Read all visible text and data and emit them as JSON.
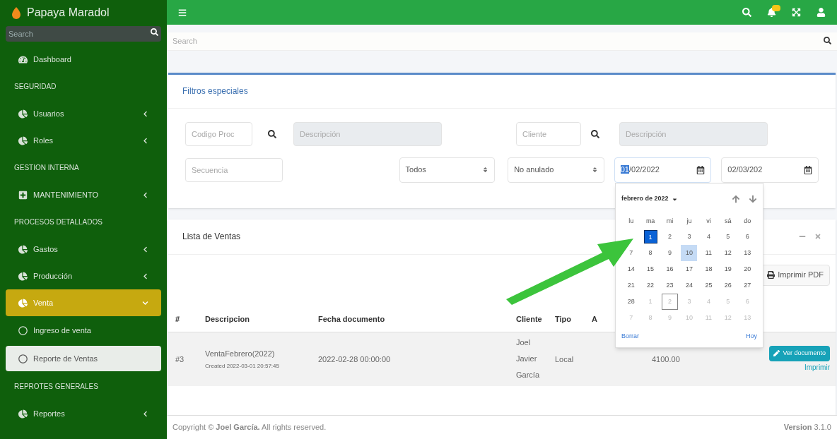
{
  "brand": {
    "name": "Papaya Maradol"
  },
  "sidebar": {
    "search": {
      "placeholder": "Search"
    },
    "items": [
      {
        "kind": "item",
        "label": "Dashboard",
        "selected": false,
        "expandable": false,
        "expanded": false
      },
      {
        "kind": "header",
        "label": "SEGURIDAD"
      },
      {
        "kind": "item",
        "label": "Usuarios",
        "selected": false,
        "expandable": true,
        "expanded": false
      },
      {
        "kind": "item",
        "label": "Roles",
        "selected": false,
        "expandable": true,
        "expanded": false
      },
      {
        "kind": "header",
        "label": "GESTION INTERNA"
      },
      {
        "kind": "item",
        "label": "MANTENIMIENTO",
        "selected": false,
        "expandable": true,
        "expanded": false
      },
      {
        "kind": "header",
        "label": "PROCESOS DETALLADOS"
      },
      {
        "kind": "item",
        "label": "Gastos",
        "selected": false,
        "expandable": true,
        "expanded": false
      },
      {
        "kind": "item",
        "label": "Producción",
        "selected": false,
        "expandable": true,
        "expanded": false
      },
      {
        "kind": "item",
        "label": "Venta",
        "selected": true,
        "expandable": true,
        "expanded": true
      },
      {
        "kind": "subitem",
        "label": "Ingreso de venta",
        "selected": false
      },
      {
        "kind": "subitem",
        "label": "Reporte de Ventas",
        "selected": true
      },
      {
        "kind": "header",
        "label": "REPROTES GENERALES"
      },
      {
        "kind": "item",
        "label": "Reportes",
        "selected": false,
        "expandable": true,
        "expanded": false
      }
    ]
  },
  "search": {
    "placeholder": "Search"
  },
  "filters": {
    "title": "Filtros especiales",
    "codigo": {
      "placeholder": "Codigo Proc"
    },
    "descripcion_producto": {
      "placeholder": "Descripción"
    },
    "cliente": {
      "placeholder": "Cliente"
    },
    "descripcion_cliente": {
      "placeholder": "Descripción"
    },
    "secuencia": {
      "placeholder": "Secuencia"
    },
    "tipo": {
      "value": "Todos"
    },
    "estado": {
      "value": "No anulado"
    },
    "fecha_desde": {
      "value": "01/02/2022",
      "focused": true
    },
    "fecha_hasta": {
      "value": "02/03/202",
      "focused": false
    }
  },
  "calendar": {
    "month": "febrero de 2022",
    "weekdays": [
      "lu",
      "ma",
      "mi",
      "ju",
      "vi",
      "sá",
      "do"
    ],
    "weeks": [
      [
        {
          "day": "1",
          "outside": false,
          "selected": true,
          "today": false,
          "focus": false
        },
        {
          "day": "2",
          "outside": false,
          "selected": false,
          "today": false,
          "focus": false
        },
        {
          "day": "3",
          "outside": false,
          "selected": false,
          "today": false,
          "focus": false
        },
        {
          "day": "4",
          "outside": false,
          "selected": false,
          "today": false,
          "focus": false
        },
        {
          "day": "5",
          "outside": false,
          "selected": false,
          "today": false,
          "focus": false
        },
        {
          "day": "6",
          "outside": false,
          "selected": false,
          "today": false,
          "focus": false
        }
      ],
      [
        {
          "day": "7",
          "outside": false,
          "selected": false,
          "today": false,
          "focus": false
        },
        {
          "day": "8",
          "outside": false,
          "selected": false,
          "today": false,
          "focus": false
        },
        {
          "day": "9",
          "outside": false,
          "selected": false,
          "today": false,
          "focus": false
        },
        {
          "day": "10",
          "outside": false,
          "selected": false,
          "today": true,
          "focus": false
        },
        {
          "day": "11",
          "outside": false,
          "selected": false,
          "today": false,
          "focus": false
        },
        {
          "day": "12",
          "outside": false,
          "selected": false,
          "today": false,
          "focus": false
        },
        {
          "day": "13",
          "outside": false,
          "selected": false,
          "today": false,
          "focus": false
        }
      ],
      [
        {
          "day": "14",
          "outside": false,
          "selected": false,
          "today": false,
          "focus": false
        },
        {
          "day": "15",
          "outside": false,
          "selected": false,
          "today": false,
          "focus": false
        },
        {
          "day": "16",
          "outside": false,
          "selected": false,
          "today": false,
          "focus": false
        },
        {
          "day": "17",
          "outside": false,
          "selected": false,
          "today": false,
          "focus": false
        },
        {
          "day": "18",
          "outside": false,
          "selected": false,
          "today": false,
          "focus": false
        },
        {
          "day": "19",
          "outside": false,
          "selected": false,
          "today": false,
          "focus": false
        },
        {
          "day": "20",
          "outside": false,
          "selected": false,
          "today": false,
          "focus": false
        }
      ],
      [
        {
          "day": "21",
          "outside": false,
          "selected": false,
          "today": false,
          "focus": false
        },
        {
          "day": "22",
          "outside": false,
          "selected": false,
          "today": false,
          "focus": false
        },
        {
          "day": "23",
          "outside": false,
          "selected": false,
          "today": false,
          "focus": false
        },
        {
          "day": "24",
          "outside": false,
          "selected": false,
          "today": false,
          "focus": false
        },
        {
          "day": "25",
          "outside": false,
          "selected": false,
          "today": false,
          "focus": false
        },
        {
          "day": "26",
          "outside": false,
          "selected": false,
          "today": false,
          "focus": false
        },
        {
          "day": "27",
          "outside": false,
          "selected": false,
          "today": false,
          "focus": false
        }
      ],
      [
        {
          "day": "28",
          "outside": false,
          "selected": false,
          "today": false,
          "focus": false
        },
        {
          "day": "1",
          "outside": true,
          "selected": false,
          "today": false,
          "focus": false
        },
        {
          "day": "2",
          "outside": true,
          "selected": false,
          "today": false,
          "focus": true
        },
        {
          "day": "3",
          "outside": true,
          "selected": false,
          "today": false,
          "focus": false
        },
        {
          "day": "4",
          "outside": true,
          "selected": false,
          "today": false,
          "focus": false
        },
        {
          "day": "5",
          "outside": true,
          "selected": false,
          "today": false,
          "focus": false
        },
        {
          "day": "6",
          "outside": true,
          "selected": false,
          "today": false,
          "focus": false
        }
      ],
      [
        {
          "day": "7",
          "outside": true,
          "selected": false,
          "today": false,
          "focus": false
        },
        {
          "day": "8",
          "outside": true,
          "selected": false,
          "today": false,
          "focus": false
        },
        {
          "day": "9",
          "outside": true,
          "selected": false,
          "today": false,
          "focus": false
        },
        {
          "day": "10",
          "outside": true,
          "selected": false,
          "today": false,
          "focus": false
        },
        {
          "day": "11",
          "outside": true,
          "selected": false,
          "today": false,
          "focus": false
        },
        {
          "day": "12",
          "outside": true,
          "selected": false,
          "today": false,
          "focus": false
        },
        {
          "day": "13",
          "outside": true,
          "selected": false,
          "today": false,
          "focus": false
        }
      ]
    ],
    "clear": "Borrar",
    "today_button": "Hoy"
  },
  "sales": {
    "title": "Lista de Ventas",
    "print_button": "Imprimir PDF",
    "columns": [
      "#",
      "Descripcion",
      "Fecha documento",
      "Cliente",
      "Tipo",
      "A"
    ],
    "rows": [
      {
        "number": "#3",
        "description": "VentaFebrero(2022)",
        "created": "Created 2022-03-01 20:57:45",
        "date": "2022-02-28 00:00:00",
        "client": [
          "Joel",
          "Javier",
          "García"
        ],
        "type": "Local",
        "amount": "4100.00",
        "view_button": "Ver documento",
        "print_link": "Imprimir"
      }
    ]
  },
  "footer": {
    "copyright": "Copyright © **Joel García.** All rights reserved.",
    "version": "**Version** 3.1.0"
  }
}
